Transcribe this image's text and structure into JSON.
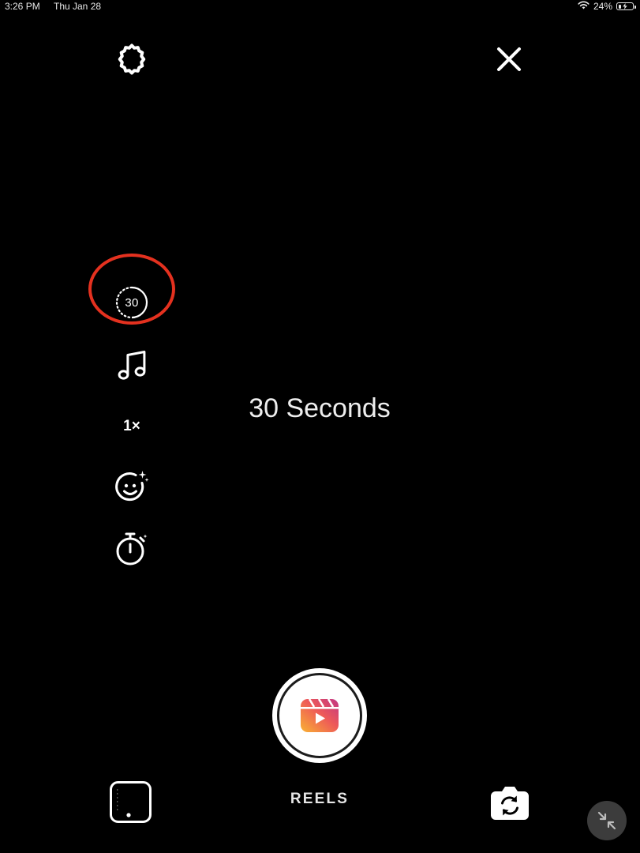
{
  "status_bar": {
    "time": "3:26 PM",
    "date": "Thu Jan 28",
    "battery_text": "24%",
    "battery_level": 0.24,
    "wifi_icon": "wifi-icon",
    "charging_icon": "bolt-icon"
  },
  "top_bar": {
    "settings_icon": "gear-icon",
    "close_icon": "close-icon"
  },
  "sidebar": {
    "length_label": "30",
    "length_icon": "dotted-circle-icon",
    "audio_icon": "music-note-icon",
    "speed_label": "1×",
    "effects_icon": "sparkle-face-icon",
    "timer_icon": "stopwatch-icon"
  },
  "center": {
    "length_text": "30 Seconds"
  },
  "bottom_bar": {
    "capture_icon": "reels-icon",
    "mode_label": "REELS",
    "gallery_icon": "gallery-icon",
    "flip_icon": "flip-camera-icon",
    "minimize_icon": "minimize-icon"
  },
  "colors": {
    "background": "#000000",
    "foreground": "#ffffff",
    "highlight": "#e4311f",
    "reels_gradient_start": "#f9b233",
    "reels_gradient_end": "#c13584"
  }
}
